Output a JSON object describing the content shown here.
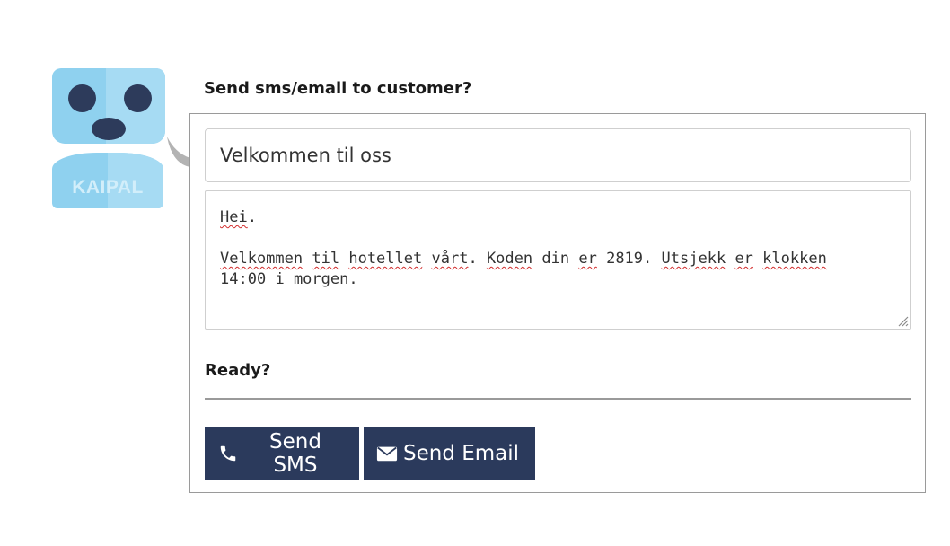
{
  "mascot": {
    "brand_text": "KAIPAL",
    "colors": {
      "light": "#8fd1ef",
      "highlight": "#a6dbf3",
      "features": "#2d3b5b"
    }
  },
  "prompt": {
    "title": "Send sms/email to customer?"
  },
  "form": {
    "subject_value": "Velkommen til oss",
    "message": {
      "lines": [
        "Hei.",
        "",
        "Velkommen til hotellet vårt. Koden din er 2819. Utsjekk er klokken",
        "14:00 i morgen."
      ],
      "misspelled_words": [
        "Hei",
        "Velkommen",
        "til",
        "hotellet",
        "vårt",
        "Koden",
        "er",
        "Utsjekk",
        "klokken"
      ]
    },
    "ready_label": "Ready?"
  },
  "actions": {
    "send_sms": {
      "label": "Send SMS",
      "icon": "phone-icon"
    },
    "send_email": {
      "label": "Send Email",
      "icon": "envelope-icon"
    },
    "button_color": "#2b3a5c"
  }
}
